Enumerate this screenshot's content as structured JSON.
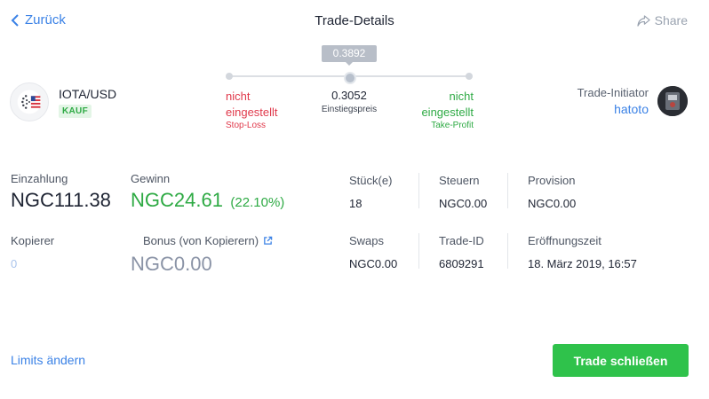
{
  "header": {
    "back_label": "Zurück",
    "title": "Trade-Details",
    "share_label": "Share"
  },
  "asset": {
    "name": "IOTA/USD",
    "side": "KAUF"
  },
  "levels": {
    "current": "0.3892",
    "stop_loss_value": "nicht eingestellt",
    "stop_loss_label": "Stop-Loss",
    "entry_value": "0.3052",
    "entry_label": "Einstiegspreis",
    "take_profit_value": "nicht eingestellt",
    "take_profit_label": "Take-Profit"
  },
  "initiator": {
    "label": "Trade-Initiator",
    "name": "hatoto"
  },
  "stats": {
    "deposit_label": "Einzahlung",
    "deposit_value": "NGC111.38",
    "profit_label": "Gewinn",
    "profit_value": "NGC24.61",
    "profit_pct": "(22.10%)",
    "units_label": "Stück(e)",
    "units_value": "18",
    "tax_label": "Steuern",
    "tax_value": "NGC0.00",
    "commission_label": "Provision",
    "commission_value": "NGC0.00",
    "copiers_label": "Kopierer",
    "copiers_value": "0",
    "bonus_label": "Bonus (von Kopierern)",
    "bonus_value": "NGC0.00",
    "swaps_label": "Swaps",
    "swaps_value": "NGC0.00",
    "trade_id_label": "Trade-ID",
    "trade_id_value": "6809291",
    "open_time_label": "Eröffnungszeit",
    "open_time_value": "18. März 2019, 16:57"
  },
  "footer": {
    "limits_label": "Limits ändern",
    "close_label": "Trade schließen"
  },
  "colors": {
    "accent_blue": "#3b82e6",
    "profit_green": "#2eaa44",
    "loss_red": "#e0394b",
    "button_green": "#2fc24b"
  }
}
